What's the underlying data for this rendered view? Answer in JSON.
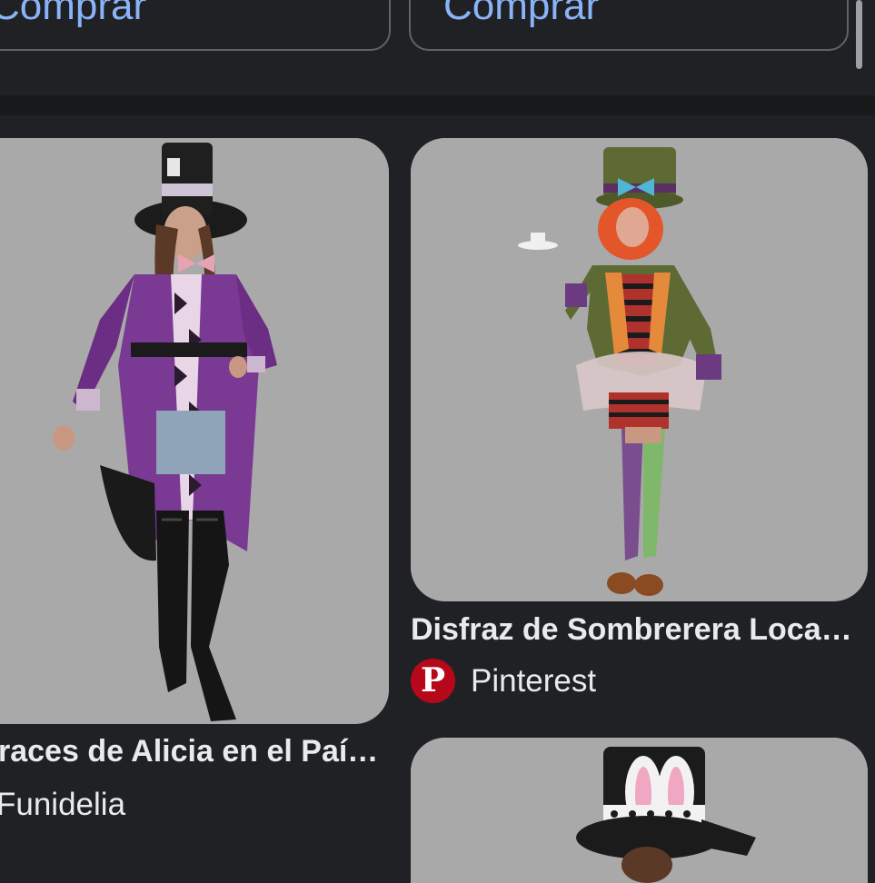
{
  "buy_buttons": {
    "left_label": "Comprar",
    "right_label": "Comprar"
  },
  "results": [
    {
      "title": "Disfraz de Sombrerera Loca de Disfraces de Alicia en el País de las Maravillas",
      "title_visible": "races de Alicia en el Paí…",
      "source": "Funidelia",
      "source_visible": "Funidelia"
    },
    {
      "title": "Disfraz de Sombrerera Loca…",
      "source": "Pinterest",
      "source_logo_icon": "pinterest-icon",
      "source_logo_color": "#b7081b"
    },
    {
      "title": "",
      "source": ""
    }
  ],
  "colors": {
    "background": "#202124",
    "divider": "#18191b",
    "link": "#8ab4f8",
    "text": "#e8eaed",
    "card_bg": "#a9a9a9"
  }
}
